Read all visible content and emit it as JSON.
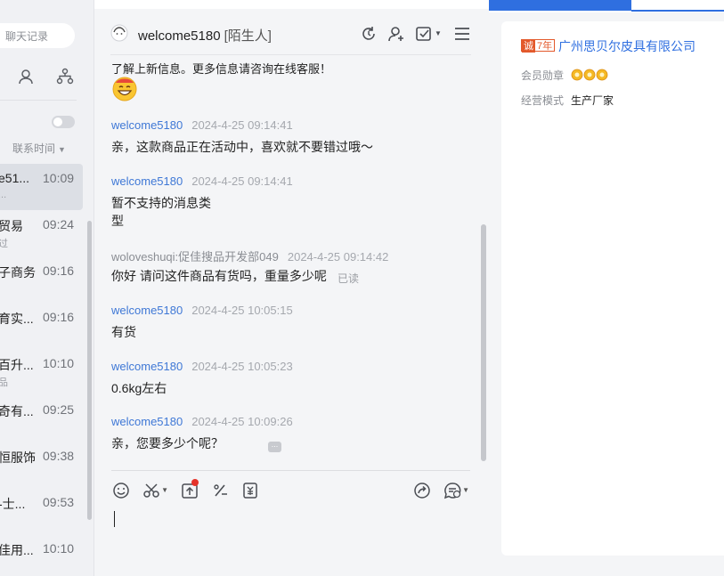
{
  "search": {
    "placeholder": "聊天记录"
  },
  "sort": {
    "label": "联系时间"
  },
  "contacts": [
    {
      "name": "e51...",
      "time": "10:09",
      "sub": "..."
    },
    {
      "name": "贸易",
      "time": "09:24",
      "sub": "过"
    },
    {
      "name": "子商务",
      "time": "09:16",
      "sub": ""
    },
    {
      "name": "育实...",
      "time": "09:16",
      "sub": ""
    },
    {
      "name": "百升...",
      "time": "10:10",
      "sub": "品"
    },
    {
      "name": "奇有...",
      "time": "09:25",
      "sub": ""
    },
    {
      "name": "恒服饰",
      "time": "09:38",
      "sub": ""
    },
    {
      "name": "-士...",
      "time": "09:53",
      "sub": ""
    },
    {
      "name": "佳用...",
      "time": "10:10",
      "sub": ""
    }
  ],
  "chat_header": {
    "name": "welcome5180",
    "tag": "[陌生人]"
  },
  "messages": {
    "intro_text": "了解上新信息。更多信息请咨询在线客服！",
    "items": [
      {
        "sender": "welcome5180",
        "time": "2024-4-25 09:14:41",
        "lines": [
          "亲，这款商品正在活动中，喜欢就不要错过哦～"
        ]
      },
      {
        "sender": "welcome5180",
        "time": "2024-4-25 09:14:41",
        "lines": [
          "暂不支持的消息类",
          "型"
        ]
      },
      {
        "sender": "woloveshuqi:促佳搜品开发部049",
        "time": "2024-4-25 09:14:42",
        "lines": [
          "你好 请问这件商品有货吗，重量多少呢"
        ],
        "status": "已读"
      },
      {
        "sender": "welcome5180",
        "time": "2024-4-25 10:05:15",
        "lines": [
          "有货"
        ]
      },
      {
        "sender": "welcome5180",
        "time": "2024-4-25 10:05:23",
        "lines": [
          "0.6kg左右"
        ]
      },
      {
        "sender": "welcome5180",
        "time": "2024-4-25 10:09:26",
        "lines": [
          "亲，您要多少个呢？"
        ]
      }
    ]
  },
  "shop": {
    "years_badge": "7年",
    "badge_icon": "诚",
    "company": "广州思贝尔皮具有限公司",
    "medal_label": "会员勋章",
    "mode_label": "经营模式",
    "mode_value": "生产厂家"
  },
  "colors": {
    "accent": "#2f6fe0",
    "sender": "#3f78d6",
    "badge": "#e3592b",
    "unread": "#e5332a"
  },
  "icons": [
    "search-icon",
    "contacts-icon",
    "org-icon",
    "refresh-icon",
    "add-friend-icon",
    "task-icon",
    "menu-icon",
    "emoji-icon",
    "scissors-icon",
    "upload-icon",
    "discount-icon",
    "coupon-icon",
    "share-icon",
    "quick-reply-icon"
  ]
}
